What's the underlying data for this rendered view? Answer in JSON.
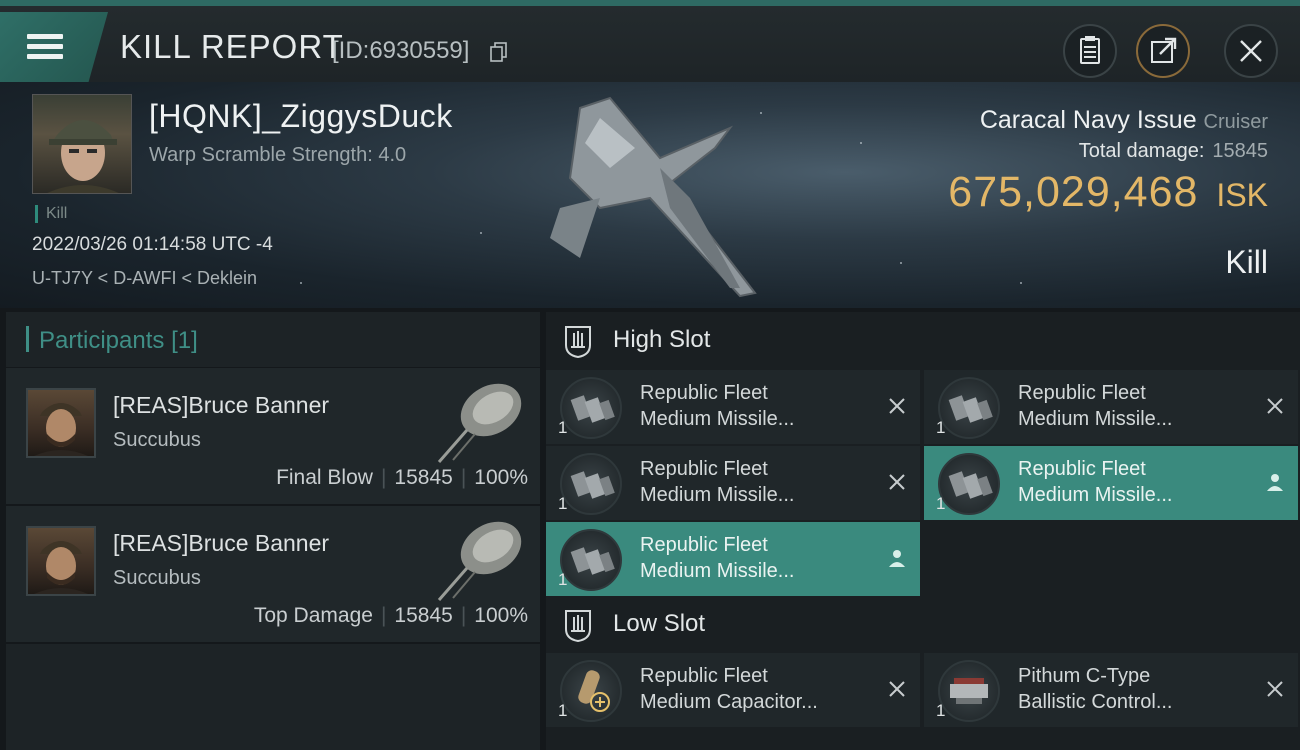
{
  "window": {
    "title": "KILL REPORT",
    "id_label": "[ID:6930559]"
  },
  "victim": {
    "name": "[HQNK]_ZiggysDuck",
    "warp_scramble": "Warp Scramble Strength: 4.0",
    "tag": "Kill",
    "datetime": "2022/03/26 01:14:58 UTC -4",
    "location": "U-TJ7Y < D-AWFI < Deklein"
  },
  "ship": {
    "name": "Caracal Navy Issue",
    "class": "Cruiser",
    "total_damage_label": "Total damage:",
    "total_damage": "15845",
    "isk_value": "675,029,468",
    "isk_unit": "ISK",
    "kind": "Kill"
  },
  "participants": {
    "header": "Participants",
    "count": "[1]",
    "rows": [
      {
        "name": "[REAS]Bruce Banner",
        "ship": "Succubus",
        "role": "Final Blow",
        "damage": "15845",
        "percent": "100%"
      },
      {
        "name": "[REAS]Bruce Banner",
        "ship": "Succubus",
        "role": "Top Damage",
        "damage": "15845",
        "percent": "100%"
      }
    ]
  },
  "high_slot": {
    "title": "High Slot",
    "modules": [
      {
        "line1": "Republic Fleet",
        "line2": "Medium Missile...",
        "qty": "1",
        "state": "destroyed"
      },
      {
        "line1": "Republic Fleet",
        "line2": "Medium Missile...",
        "qty": "1",
        "state": "destroyed"
      },
      {
        "line1": "Republic Fleet",
        "line2": "Medium Missile...",
        "qty": "1",
        "state": "destroyed"
      },
      {
        "line1": "Republic Fleet",
        "line2": "Medium Missile...",
        "qty": "1",
        "state": "dropped"
      },
      {
        "line1": "Republic Fleet",
        "line2": "Medium Missile...",
        "qty": "1",
        "state": "dropped"
      }
    ]
  },
  "low_slot": {
    "title": "Low Slot",
    "modules": [
      {
        "line1": "Republic Fleet",
        "line2": "Medium Capacitor...",
        "qty": "1",
        "state": "destroyed"
      },
      {
        "line1": "Pithum C-Type",
        "line2": "Ballistic Control...",
        "qty": "1",
        "state": "destroyed"
      }
    ]
  },
  "colors": {
    "accent": "#3a8a7e",
    "isk": "#e3b767",
    "title_bar_accent": "#2e6a63"
  }
}
